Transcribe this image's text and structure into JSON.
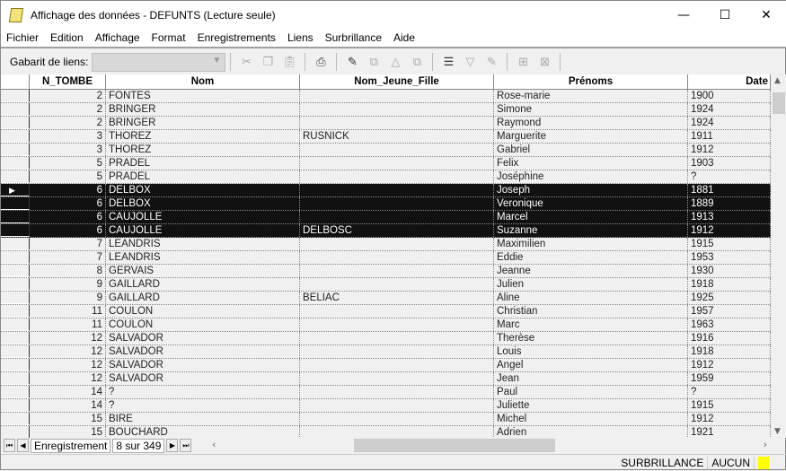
{
  "window": {
    "title": "Affichage des données - DEFUNTS (Lecture seule)",
    "minimize": "—",
    "maximize": "☐",
    "close": "✕"
  },
  "menu": [
    "Fichier",
    "Edition",
    "Affichage",
    "Format",
    "Enregistrements",
    "Liens",
    "Surbrillance",
    "Aide"
  ],
  "toolbar": {
    "template_label": "Gabarit de liens:",
    "template_value": ""
  },
  "columns": [
    "N_TOMBE",
    "Nom",
    "Nom_Jeune_Fille",
    "Prénoms",
    "Date"
  ],
  "rows": [
    [
      "2",
      "FONTES",
      "",
      "Rose-marie",
      "1900"
    ],
    [
      "2",
      "BRINGER",
      "",
      "Simone",
      "1924"
    ],
    [
      "2",
      "BRINGER",
      "",
      "Raymond",
      "1924"
    ],
    [
      "3",
      "THOREZ",
      "RUSNICK",
      "Marguerite",
      "1911"
    ],
    [
      "3",
      "THOREZ",
      "",
      "Gabriel",
      "1912"
    ],
    [
      "5",
      "PRADEL",
      "",
      "Felix",
      "1903"
    ],
    [
      "5",
      "PRADEL",
      "",
      "Joséphine",
      "?"
    ],
    [
      "6",
      "DELBOX",
      "",
      "Joseph",
      "1881"
    ],
    [
      "6",
      "DELBOX",
      "",
      "Veronique",
      "1889"
    ],
    [
      "6",
      "CAUJOLLE",
      "",
      "Marcel",
      "1913"
    ],
    [
      "6",
      "CAUJOLLE",
      "DELBOSC",
      "Suzanne",
      "1912"
    ],
    [
      "7",
      "LEANDRIS",
      "",
      "Maximilien",
      "1915"
    ],
    [
      "7",
      "LEANDRIS",
      "",
      "Eddie",
      "1953"
    ],
    [
      "8",
      "GERVAIS",
      "",
      "Jeanne",
      "1930"
    ],
    [
      "9",
      "GAILLARD",
      "",
      "Julien",
      "1918"
    ],
    [
      "9",
      "GAILLARD",
      "BELIAC",
      "Aline",
      "1925"
    ],
    [
      "11",
      "COULON",
      "",
      "Christian",
      "1957"
    ],
    [
      "11",
      "COULON",
      "",
      "Marc",
      "1963"
    ],
    [
      "12",
      "SALVADOR",
      "",
      "Therèse",
      "1916"
    ],
    [
      "12",
      "SALVADOR",
      "",
      "Louis",
      "1918"
    ],
    [
      "12",
      "SALVADOR",
      "",
      "Angel",
      "1912"
    ],
    [
      "12",
      "SALVADOR",
      "",
      "Jean",
      "1959"
    ],
    [
      "14",
      "?",
      "",
      "Paul",
      "?"
    ],
    [
      "14",
      "?",
      "",
      "Juliette",
      "1915"
    ],
    [
      "15",
      "BIRE",
      "",
      "Michel",
      "1912"
    ],
    [
      "15",
      "BOUCHARD",
      "",
      "Adrien",
      "1921"
    ]
  ],
  "selected_rows": [
    7,
    8,
    9,
    10
  ],
  "current_row": 7,
  "navigator": {
    "label": "Enregistrement",
    "position": "8 sur 349"
  },
  "status": {
    "highlight_label": "SURBRILLANCE",
    "highlight_value": "AUCUN",
    "highlight_color": "#ffff00"
  }
}
